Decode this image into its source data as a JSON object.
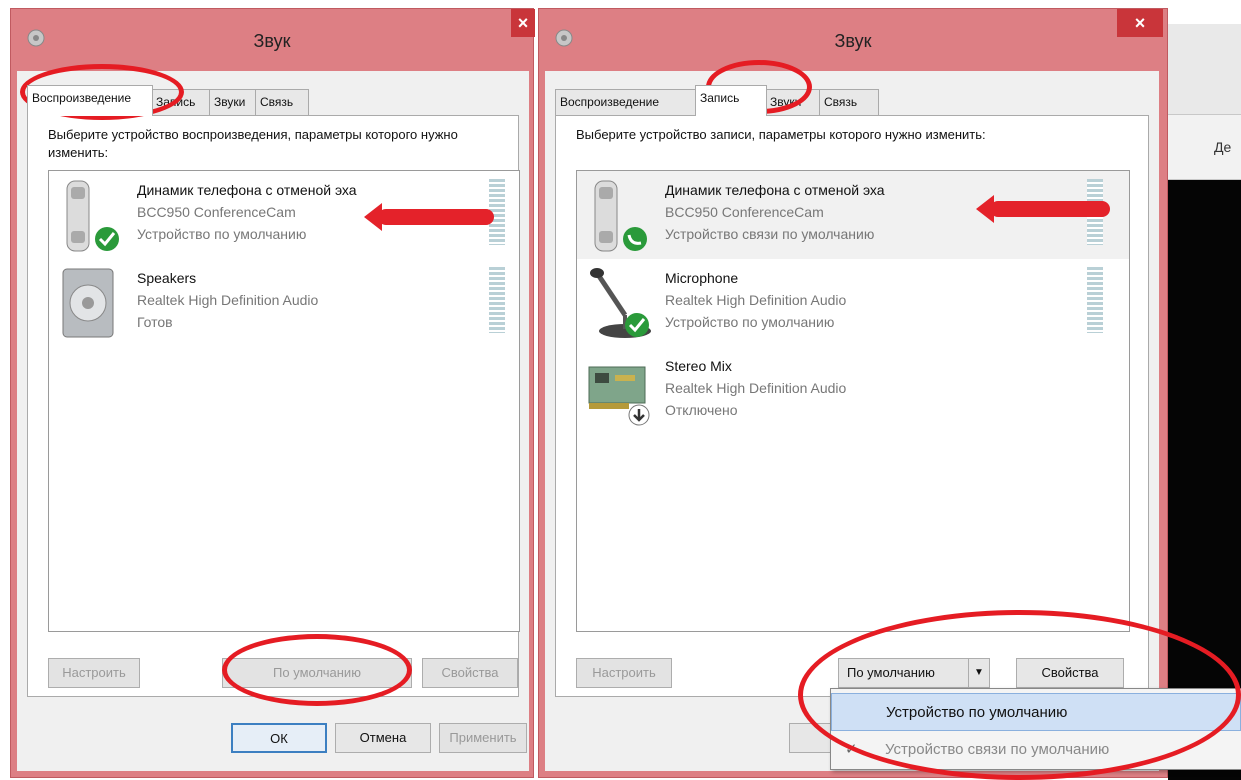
{
  "background": {
    "tab_label": "Де"
  },
  "left": {
    "title": "Звук",
    "tabs": [
      "Воспроизведение",
      "Запись",
      "Звуки",
      "Связь"
    ],
    "prompt": "Выберите устройство воспроизведения, параметры которого нужно изменить:",
    "devices": [
      {
        "name": "Динамик телефона с отменой эха",
        "model": "BCC950 ConferenceCam",
        "status": "Устройство по умолчанию",
        "icon": "handset-icon",
        "badge": "default-check-icon"
      },
      {
        "name": "Speakers",
        "model": "Realtek High Definition Audio",
        "status": "Готов",
        "icon": "speaker-icon",
        "badge": ""
      }
    ],
    "buttons": {
      "configure": "Настроить",
      "default": "По умолчанию",
      "properties": "Свойства",
      "ok": "ОК",
      "cancel": "Отмена",
      "apply": "Применить"
    }
  },
  "right": {
    "title": "Звук",
    "tabs": [
      "Воспроизведение",
      "Запись",
      "Звуки",
      "Связь"
    ],
    "prompt": "Выберите устройство записи, параметры которого нужно изменить:",
    "devices": [
      {
        "name": "Динамик телефона с отменой эха",
        "model": "BCC950 ConferenceCam",
        "status": "Устройство связи по умолчанию",
        "icon": "handset-icon",
        "badge": "phone-badge-icon"
      },
      {
        "name": "Microphone",
        "model": "Realtek High Definition Audio",
        "status": "Устройство по умолчанию",
        "icon": "microphone-icon",
        "badge": "default-check-icon"
      },
      {
        "name": "Stereo Mix",
        "model": "Realtek High Definition Audio",
        "status": "Отключено",
        "icon": "sound-card-icon",
        "badge": "disabled-arrow-icon"
      }
    ],
    "buttons": {
      "configure": "Настроить",
      "default": "По умолчанию",
      "properties": "Свойства"
    },
    "dropdown": [
      "Устройство по умолчанию",
      "Устройство связи по умолчанию"
    ]
  },
  "colors": {
    "titlebar": "#dd7f84",
    "close": "#c9353a",
    "annotation": "#e51c23",
    "highlight": "#cfe0f5"
  }
}
